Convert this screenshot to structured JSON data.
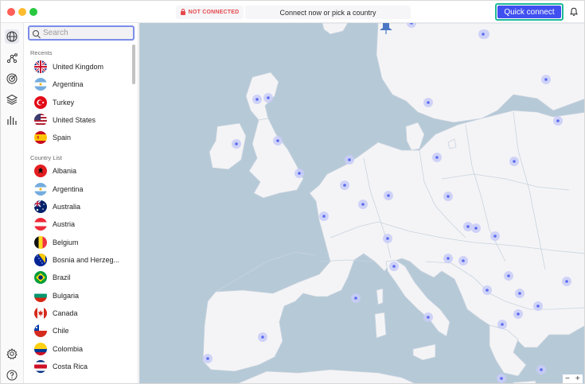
{
  "header": {
    "status_text": "NOT CONNECTED",
    "connect_message": "Connect now or pick a country",
    "quick_connect_label": "Quick connect"
  },
  "search": {
    "placeholder": "Search"
  },
  "sidebar": {
    "recents_label": "Recents",
    "recents": [
      {
        "label": "United Kingdom",
        "flag": "uk"
      },
      {
        "label": "Argentina",
        "flag": "ar"
      },
      {
        "label": "Turkey",
        "flag": "tr"
      },
      {
        "label": "United States",
        "flag": "us"
      },
      {
        "label": "Spain",
        "flag": "es"
      }
    ],
    "country_list_label": "Country List",
    "countries": [
      {
        "label": "Albania",
        "flag": "al"
      },
      {
        "label": "Argentina",
        "flag": "ar"
      },
      {
        "label": "Australia",
        "flag": "au"
      },
      {
        "label": "Austria",
        "flag": "at"
      },
      {
        "label": "Belgium",
        "flag": "be"
      },
      {
        "label": "Bosnia and Herzeg...",
        "flag": "ba"
      },
      {
        "label": "Brazil",
        "flag": "br"
      },
      {
        "label": "Bulgaria",
        "flag": "bg"
      },
      {
        "label": "Canada",
        "flag": "ca"
      },
      {
        "label": "Chile",
        "flag": "cl"
      },
      {
        "label": "Colombia",
        "flag": "co"
      },
      {
        "label": "Costa Rica",
        "flag": "cr"
      }
    ]
  },
  "rail": {
    "icons": [
      "globe-icon",
      "meshnet-icon",
      "threat-protection-icon",
      "layers-icon",
      "stats-icon",
      "settings-icon",
      "help-icon"
    ]
  },
  "map": {
    "zoom_out": "−",
    "zoom_in": "+"
  },
  "colors": {
    "accent": "#4050f0",
    "highlight": "#1fb99a",
    "status_red": "#e5484d",
    "sea": "#b6c9d7",
    "land": "#f4f4f6",
    "pin": "#5b6cf0"
  }
}
